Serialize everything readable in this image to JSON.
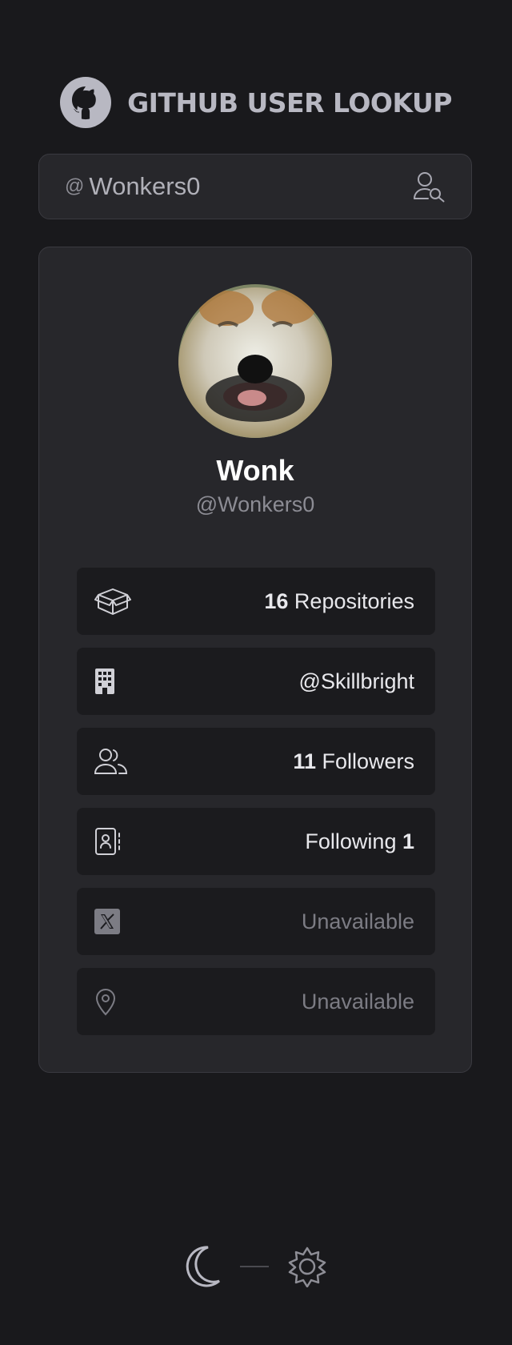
{
  "header": {
    "logo_icon": "github-octocat-icon",
    "title": "GITHUB USER LOOKUP"
  },
  "search": {
    "prefix": "@",
    "value": "Wonkers0",
    "button_icon": "user-search-icon"
  },
  "profile": {
    "avatar_icon": "avatar-shiba-dog",
    "name": "Wonk",
    "login": "@Wonkers0"
  },
  "stats": [
    {
      "icon": "box-icon",
      "num": "16",
      "text": " Repositories",
      "num_first": true,
      "dim": false
    },
    {
      "icon": "building-icon",
      "num": "",
      "text": "@Skillbright",
      "num_first": true,
      "dim": false
    },
    {
      "icon": "users-icon",
      "num": "11",
      "text": " Followers",
      "num_first": true,
      "dim": false
    },
    {
      "icon": "contact-book-icon",
      "num": "1",
      "text": "Following ",
      "num_first": false,
      "dim": false
    },
    {
      "icon": "x-twitter-icon",
      "num": "",
      "text": "Unavailable",
      "num_first": true,
      "dim": true
    },
    {
      "icon": "location-pin-icon",
      "num": "",
      "text": "Unavailable",
      "num_first": true,
      "dim": true
    }
  ],
  "theme_toggle": {
    "dark_icon": "moon-icon",
    "light_icon": "sun-icon"
  },
  "colors": {
    "background": "#19191c",
    "card": "#27272b",
    "stat_row": "#1b1b1e",
    "border": "#3a3a40",
    "title": "#b8b8c2"
  }
}
